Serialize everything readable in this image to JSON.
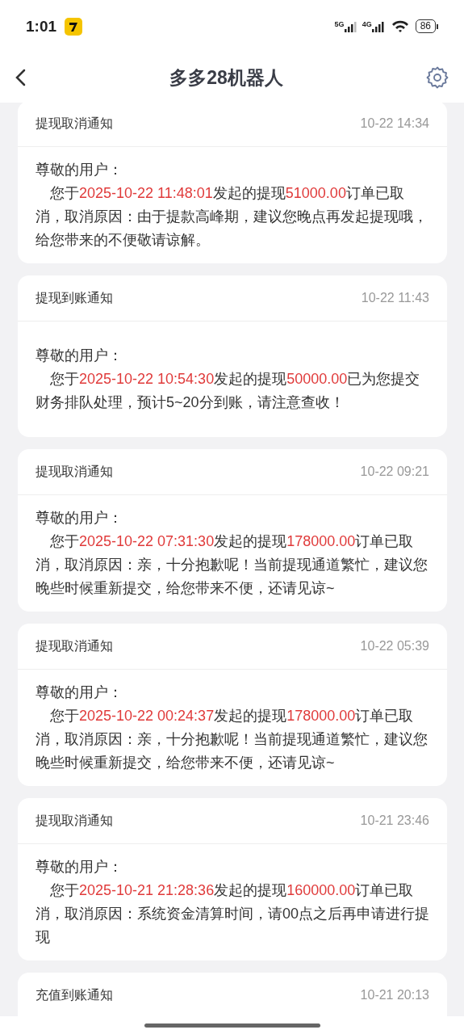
{
  "status_bar": {
    "time": "1:01",
    "network_1": "5G",
    "network_2": "4G",
    "battery": "86"
  },
  "header": {
    "title": "多多28机器人"
  },
  "notifications": [
    {
      "title": "提现取消通知",
      "time": "10-22 14:34",
      "greeting": "尊敬的用户：",
      "message": [
        {
          "kind": "plain",
          "text": "您于"
        },
        {
          "kind": "highlight",
          "text": "2025-10-22 11:48:01"
        },
        {
          "kind": "plain",
          "text": "发起的提现"
        },
        {
          "kind": "highlight",
          "text": "51000.00"
        },
        {
          "kind": "plain",
          "text": "订单已取消，取消原因：由于提款高峰期，建议您晚点再发起提现哦，给您带来的不便敬请谅解。"
        }
      ]
    },
    {
      "title": "提现到账通知",
      "time": "10-22 11:43",
      "greeting": "尊敬的用户：",
      "message": [
        {
          "kind": "plain",
          "text": "您于"
        },
        {
          "kind": "highlight",
          "text": "2025-10-22 10:54:30"
        },
        {
          "kind": "plain",
          "text": "发起的提现"
        },
        {
          "kind": "highlight",
          "text": "50000.00"
        },
        {
          "kind": "plain",
          "text": "已为您提交财务排队处理，预计5~20分到账，请注意查收！"
        }
      ]
    },
    {
      "title": "提现取消通知",
      "time": "10-22 09:21",
      "greeting": "尊敬的用户：",
      "message": [
        {
          "kind": "plain",
          "text": "您于"
        },
        {
          "kind": "highlight",
          "text": "2025-10-22 07:31:30"
        },
        {
          "kind": "plain",
          "text": "发起的提现"
        },
        {
          "kind": "highlight",
          "text": "178000.00"
        },
        {
          "kind": "plain",
          "text": "订单已取消，取消原因：亲，十分抱歉呢！当前提现通道繁忙，建议您晚些时候重新提交，给您带来不便，还请见谅~"
        }
      ]
    },
    {
      "title": "提现取消通知",
      "time": "10-22 05:39",
      "greeting": "尊敬的用户：",
      "message": [
        {
          "kind": "plain",
          "text": "您于"
        },
        {
          "kind": "highlight",
          "text": "2025-10-22 00:24:37"
        },
        {
          "kind": "plain",
          "text": "发起的提现"
        },
        {
          "kind": "highlight",
          "text": "178000.00"
        },
        {
          "kind": "plain",
          "text": "订单已取消，取消原因：亲，十分抱歉呢！当前提现通道繁忙，建议您晚些时候重新提交，给您带来不便，还请见谅~"
        }
      ]
    },
    {
      "title": "提现取消通知",
      "time": "10-21 23:46",
      "greeting": "尊敬的用户：",
      "message": [
        {
          "kind": "plain",
          "text": "您于"
        },
        {
          "kind": "highlight",
          "text": "2025-10-21 21:28:36"
        },
        {
          "kind": "plain",
          "text": "发起的提现"
        },
        {
          "kind": "highlight",
          "text": "160000.00"
        },
        {
          "kind": "plain",
          "text": "订单已取消，取消原因：系统资金清算时间，请00点之后再申请进行提现"
        }
      ]
    },
    {
      "title": "充值到账通知",
      "time": "10-21 20:13"
    }
  ]
}
